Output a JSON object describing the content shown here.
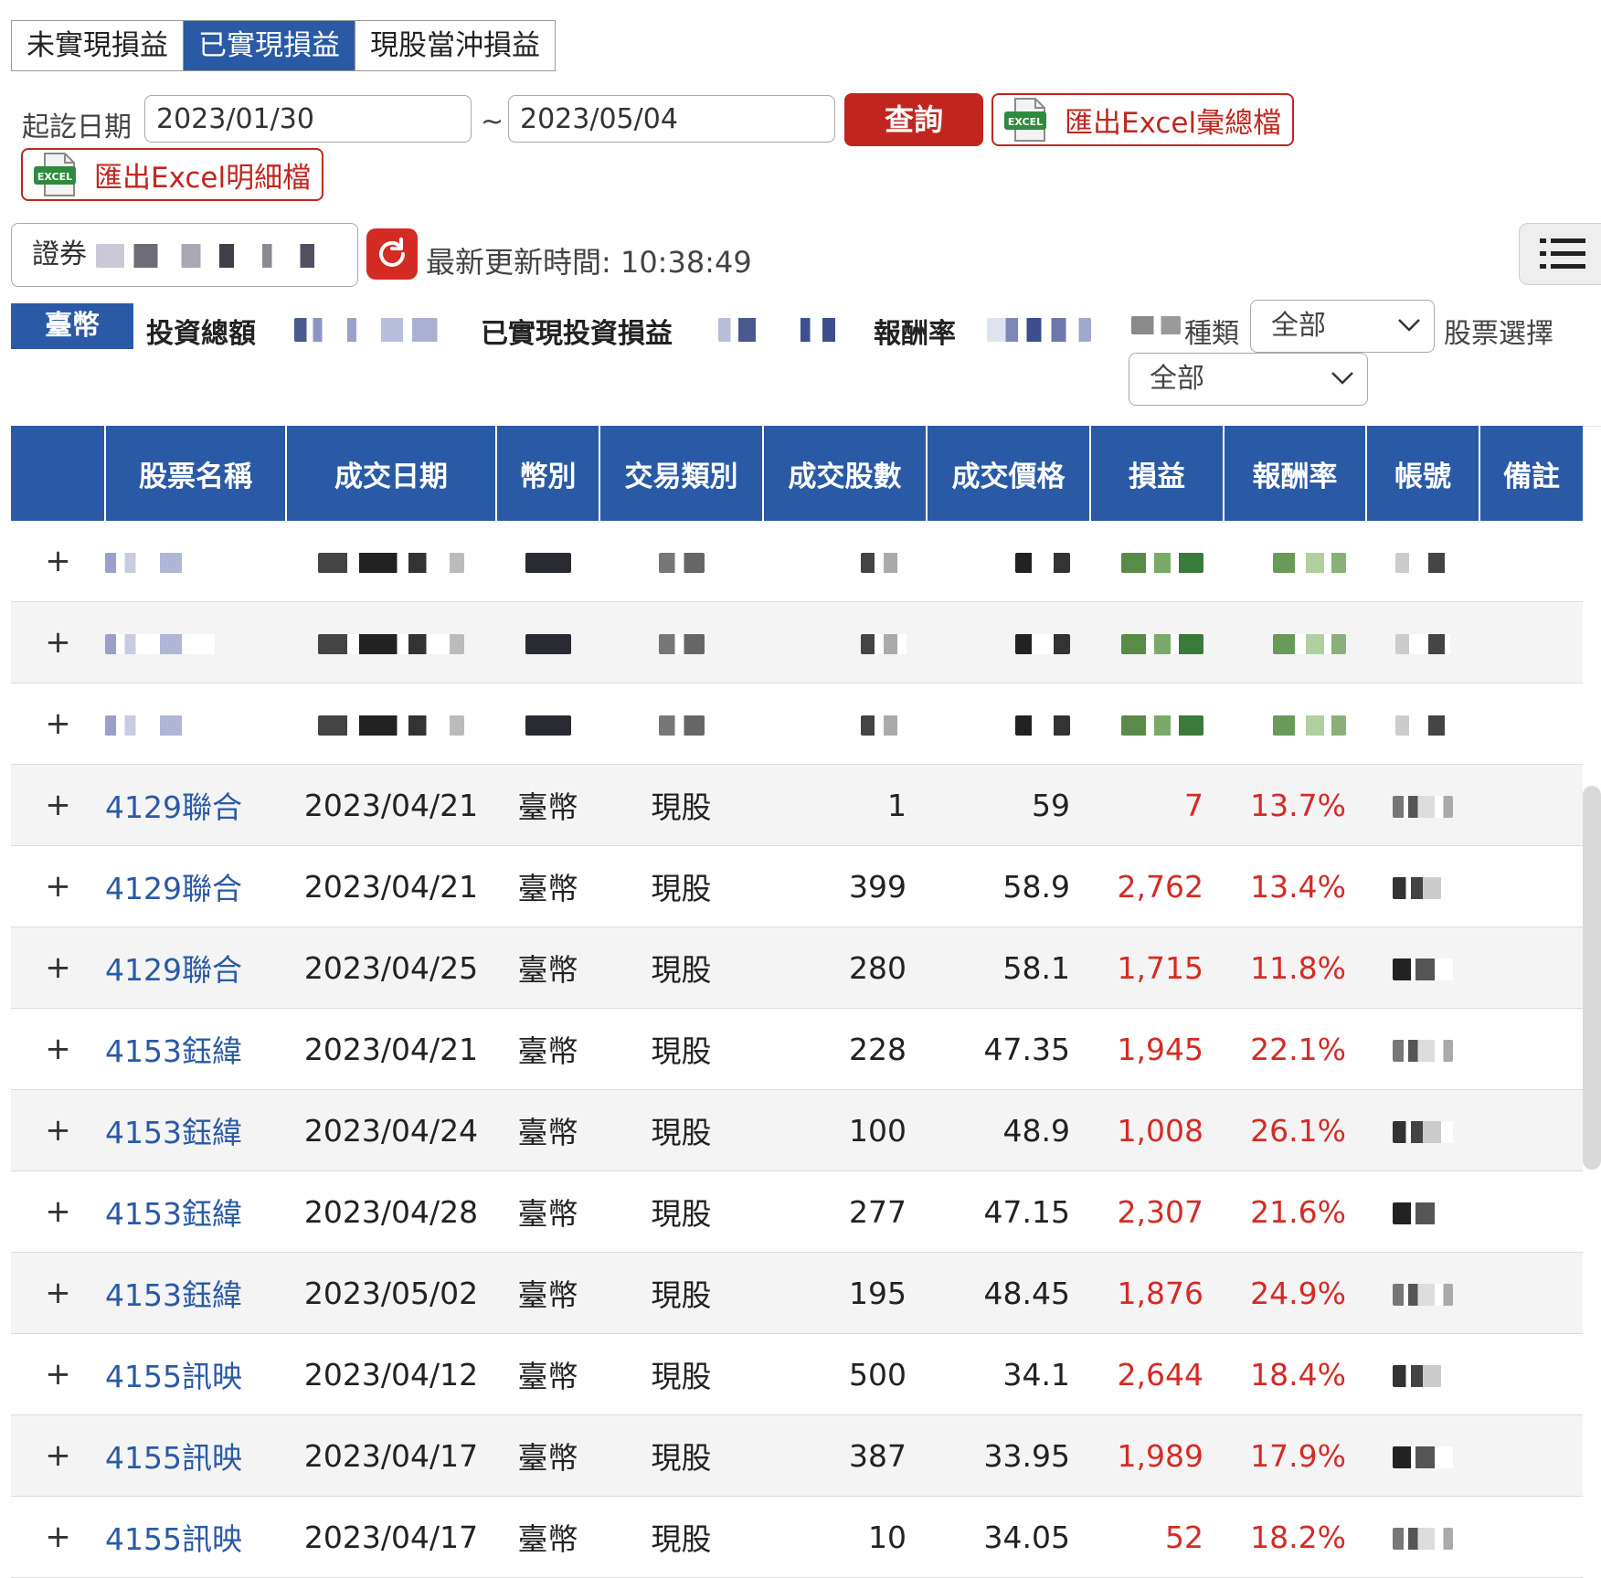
{
  "tabs": [
    {
      "label": "未實現損益",
      "active": false
    },
    {
      "label": "已實現損益",
      "active": true
    },
    {
      "label": "現股當沖損益",
      "active": false
    }
  ],
  "query": {
    "date_label": "起訖日期",
    "start_date": "2023/01/30",
    "separator": "~",
    "end_date": "2023/05/04",
    "query_button": "查詢",
    "export_summary": "匯出Excel彙總檔",
    "export_detail": "匯出Excel明細檔",
    "excel_icon_text": "EXCEL"
  },
  "account": {
    "prefix": "證券",
    "updated_label": "最新更新時間: 10:38:49"
  },
  "summary": {
    "currency": "臺幣",
    "invest_total_label": "投資總額",
    "realized_label": "已實現投資損益",
    "return_label": "報酬率",
    "type_label": "種類",
    "type_value": "全部",
    "stock_select_label": "股票選擇",
    "stock_select_value": "全部"
  },
  "table": {
    "columns": [
      "",
      "股票名稱",
      "成交日期",
      "幣別",
      "交易類別",
      "成交股數",
      "成交價格",
      "損益",
      "報酬率",
      "帳號",
      "備註"
    ],
    "rows": [
      {
        "expand": "+",
        "name": "",
        "date": "",
        "currency": "",
        "type": "",
        "shares": "",
        "price": "",
        "pl": "",
        "rate": "",
        "account": "",
        "note": "",
        "masked": true
      },
      {
        "expand": "+",
        "name": "",
        "date": "",
        "currency": "",
        "type": "",
        "shares": "",
        "price": "",
        "pl": "",
        "rate": "",
        "account": "",
        "note": "",
        "masked": true
      },
      {
        "expand": "+",
        "name": "",
        "date": "",
        "currency": "",
        "type": "",
        "shares": "",
        "price": "",
        "pl": "",
        "rate": "",
        "account": "",
        "note": "",
        "masked": true
      },
      {
        "expand": "+",
        "name": "4129聯合",
        "date": "2023/04/21",
        "currency": "臺幣",
        "type": "現股",
        "shares": "1",
        "price": "59",
        "pl": "7",
        "rate": "13.7%",
        "account": "",
        "note": ""
      },
      {
        "expand": "+",
        "name": "4129聯合",
        "date": "2023/04/21",
        "currency": "臺幣",
        "type": "現股",
        "shares": "399",
        "price": "58.9",
        "pl": "2,762",
        "rate": "13.4%",
        "account": "",
        "note": ""
      },
      {
        "expand": "+",
        "name": "4129聯合",
        "date": "2023/04/25",
        "currency": "臺幣",
        "type": "現股",
        "shares": "280",
        "price": "58.1",
        "pl": "1,715",
        "rate": "11.8%",
        "account": "",
        "note": ""
      },
      {
        "expand": "+",
        "name": "4153鈺緯",
        "date": "2023/04/21",
        "currency": "臺幣",
        "type": "現股",
        "shares": "228",
        "price": "47.35",
        "pl": "1,945",
        "rate": "22.1%",
        "account": "",
        "note": ""
      },
      {
        "expand": "+",
        "name": "4153鈺緯",
        "date": "2023/04/24",
        "currency": "臺幣",
        "type": "現股",
        "shares": "100",
        "price": "48.9",
        "pl": "1,008",
        "rate": "26.1%",
        "account": "",
        "note": ""
      },
      {
        "expand": "+",
        "name": "4153鈺緯",
        "date": "2023/04/28",
        "currency": "臺幣",
        "type": "現股",
        "shares": "277",
        "price": "47.15",
        "pl": "2,307",
        "rate": "21.6%",
        "account": "",
        "note": ""
      },
      {
        "expand": "+",
        "name": "4153鈺緯",
        "date": "2023/05/02",
        "currency": "臺幣",
        "type": "現股",
        "shares": "195",
        "price": "48.45",
        "pl": "1,876",
        "rate": "24.9%",
        "account": "",
        "note": ""
      },
      {
        "expand": "+",
        "name": "4155訊映",
        "date": "2023/04/12",
        "currency": "臺幣",
        "type": "現股",
        "shares": "500",
        "price": "34.1",
        "pl": "2,644",
        "rate": "18.4%",
        "account": "",
        "note": ""
      },
      {
        "expand": "+",
        "name": "4155訊映",
        "date": "2023/04/17",
        "currency": "臺幣",
        "type": "現股",
        "shares": "387",
        "price": "33.95",
        "pl": "1,989",
        "rate": "17.9%",
        "account": "",
        "note": ""
      },
      {
        "expand": "+",
        "name": "4155訊映",
        "date": "2023/04/17",
        "currency": "臺幣",
        "type": "現股",
        "shares": "10",
        "price": "34.05",
        "pl": "52",
        "rate": "18.2%",
        "account": "",
        "note": ""
      }
    ]
  },
  "colors": {
    "primary": "#2a5aa6",
    "danger": "#c0261f",
    "profit": "#d42b25"
  },
  "icons": {
    "excel": "excel-file-icon",
    "refresh": "refresh-icon",
    "menu": "list-menu-icon",
    "dropdown": "chevron-down-icon"
  }
}
